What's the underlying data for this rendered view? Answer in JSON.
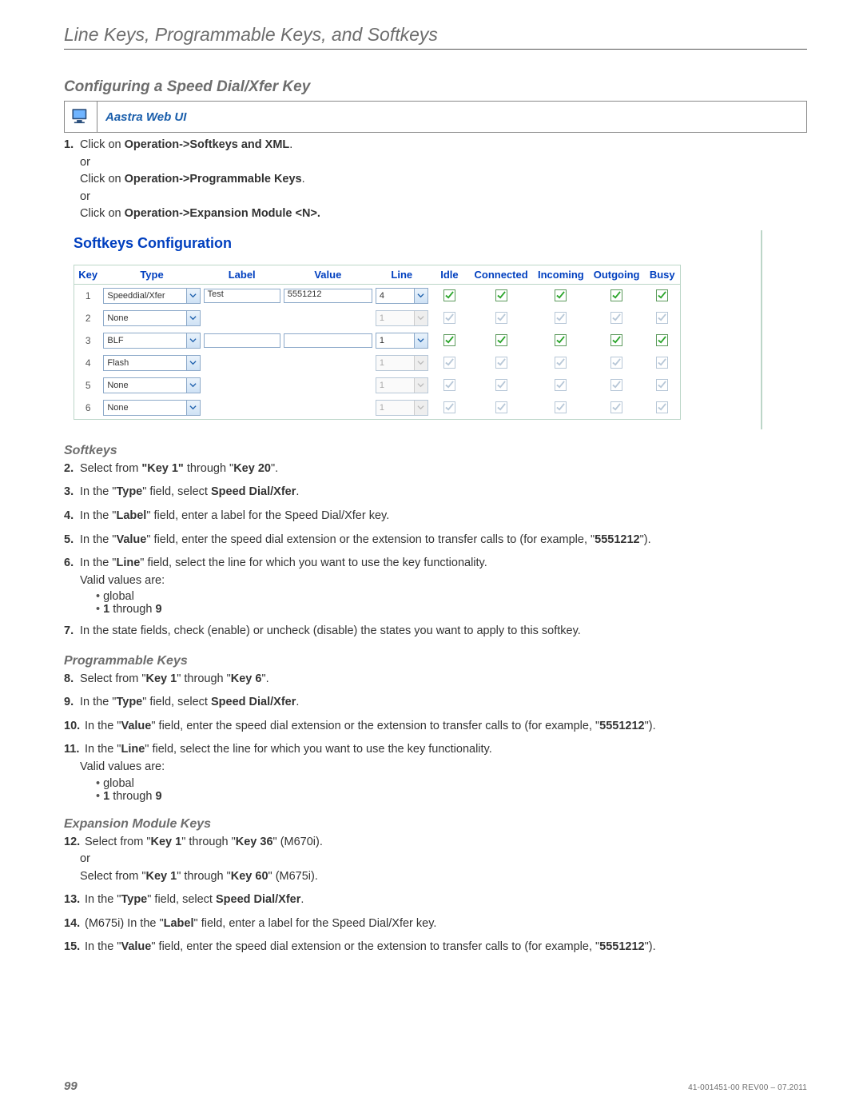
{
  "chapter": "Line Keys, Programmable Keys, and Softkeys",
  "section": "Configuring a Speed Dial/Xfer Key",
  "callout": {
    "label": "Aastra Web UI"
  },
  "step1": {
    "num": "1.",
    "pre": "Click on ",
    "b1": "Operation->Softkeys and XML",
    "post1": ".",
    "or1": "or",
    "pre2": "Click on ",
    "b2": "Operation->Programmable Keys",
    "post2": ".",
    "or2": "or",
    "pre3": "Click on ",
    "b3": "Operation->Expansion Module <N>."
  },
  "panel": {
    "title": "Softkeys Configuration",
    "headers": [
      "Key",
      "Type",
      "Label",
      "Value",
      "Line",
      "Idle",
      "Connected",
      "Incoming",
      "Outgoing",
      "Busy"
    ],
    "rows": [
      {
        "key": "1",
        "type": "Speeddial/Xfer",
        "label": "Test",
        "value": "5551212",
        "line": "4",
        "enabled": true
      },
      {
        "key": "2",
        "type": "None",
        "label": "",
        "value": "",
        "line": "1",
        "enabled": false
      },
      {
        "key": "3",
        "type": "BLF",
        "label": "",
        "value": "",
        "line": "1",
        "enabled": true
      },
      {
        "key": "4",
        "type": "Flash",
        "label": "",
        "value": "",
        "line": "1",
        "enabled": false
      },
      {
        "key": "5",
        "type": "None",
        "label": "",
        "value": "",
        "line": "1",
        "enabled": false
      },
      {
        "key": "6",
        "type": "None",
        "label": "",
        "value": "",
        "line": "1",
        "enabled": false
      }
    ]
  },
  "softkeys": {
    "heading": "Softkeys",
    "s2": {
      "num": "2.",
      "pre": "Select from ",
      "b1": "\"Key 1\"",
      "mid": " through \"",
      "b2": "Key 20",
      "post": "\"."
    },
    "s3": {
      "num": "3.",
      "pre": "In the \"",
      "b1": "Type",
      "mid": "\" field, select ",
      "b2": "Speed Dial/Xfer",
      "post": "."
    },
    "s4": {
      "num": "4.",
      "pre": "In the \"",
      "b1": "Label",
      "post": "\" field, enter a label for the Speed Dial/Xfer key."
    },
    "s5": {
      "num": "5.",
      "pre": "In the \"",
      "b1": "Value",
      "mid": "\" field, enter the speed dial extension or the extension to transfer calls to (for example, \"",
      "b2": "5551212",
      "post": "\")."
    },
    "s6": {
      "num": "6.",
      "pre": "In the \"",
      "b1": "Line",
      "post": "\" field, select the line for which you want to use the key functionality.",
      "valid": "Valid values are:",
      "bul1": "global",
      "bul2a": "1",
      "bul2b": " through ",
      "bul2c": "9"
    },
    "s7": {
      "num": "7.",
      "text": "In the state fields, check (enable) or uncheck (disable) the states you want to apply to this softkey."
    }
  },
  "progkeys": {
    "heading": "Programmable Keys",
    "s8": {
      "num": "8.",
      "pre": "Select from \"",
      "b1": "Key 1",
      "mid": "\" through \"",
      "b2": "Key 6",
      "post": "\"."
    },
    "s9": {
      "num": "9.",
      "pre": "In the \"",
      "b1": "Type",
      "mid": "\" field, select ",
      "b2": "Speed Dial/Xfer",
      "post": "."
    },
    "s10": {
      "num": "10.",
      "pre": "In the \"",
      "b1": "Value",
      "mid": "\" field, enter the speed dial extension or the extension to transfer calls to (for example, \"",
      "b2": "5551212",
      "post": "\")."
    },
    "s11": {
      "num": "11.",
      "pre": "In the \"",
      "b1": "Line",
      "post": "\" field, select the line for which you want to use the key functionality.",
      "valid": "Valid values are:",
      "bul1": "global",
      "bul2a": "1",
      "bul2b": " through ",
      "bul2c": "9"
    }
  },
  "expmod": {
    "heading": "Expansion Module Keys",
    "s12": {
      "num": "12.",
      "pre": "Select from \"",
      "b1": "Key 1",
      "mid": "\" through \"",
      "b2": "Key 36",
      "post": "\" (M670i).",
      "or": "or",
      "pre2": "Select from \"",
      "b3": "Key 1",
      "mid2": "\" through \"",
      "b4": "Key 60",
      "post2": "\" (M675i)."
    },
    "s13": {
      "num": "13.",
      "pre": "In the \"",
      "b1": "Type",
      "mid": "\" field, select ",
      "b2": "Speed Dial/Xfer",
      "post": "."
    },
    "s14": {
      "num": "14.",
      "pre": "(M675i) In the \"",
      "b1": "Label",
      "post": "\" field, enter a label for the Speed Dial/Xfer key."
    },
    "s15": {
      "num": "15.",
      "pre": "In the \"",
      "b1": "Value",
      "mid": "\" field, enter the speed dial extension or the extension to transfer calls to (for example, \"",
      "b2": "5551212",
      "post": "\")."
    }
  },
  "footer": {
    "page": "99",
    "doc": "41-001451-00 REV00 – 07.2011"
  }
}
